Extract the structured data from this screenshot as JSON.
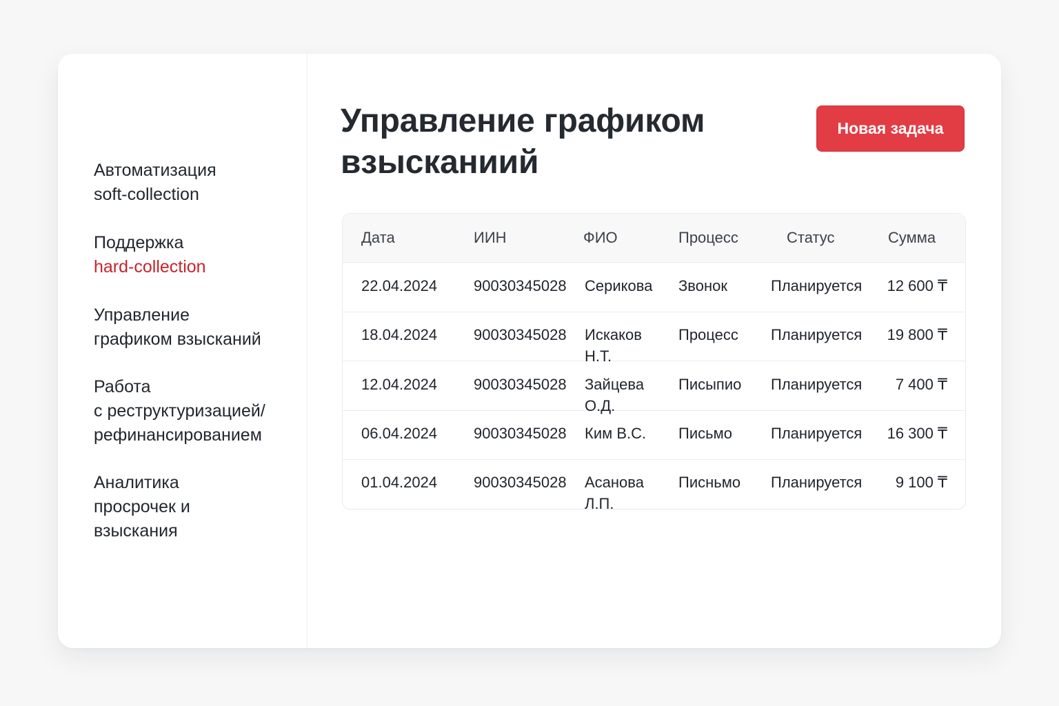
{
  "sidebar": {
    "items": [
      {
        "lines": [
          "Автоматизация",
          "soft-collection"
        ]
      },
      {
        "line1": "Поддержка",
        "line2": "hard-collection"
      },
      {
        "lines": [
          "Управление",
          "графиком взысканий"
        ]
      },
      {
        "lines": [
          "Работа",
          "с реструктуризацией/",
          "рефинансированием"
        ]
      },
      {
        "lines": [
          "Аналитика",
          "просрочек и",
          "взыскания"
        ]
      }
    ]
  },
  "colors": {
    "accent": "#c8232b",
    "button": "#e23d45"
  },
  "header": {
    "title_lines": [
      "Управление графиком",
      "взысканиий"
    ],
    "new_task_label": "Новая задача"
  },
  "table": {
    "columns": [
      "Дата",
      "ИИН",
      "ФИО",
      "Процесс",
      "Статус",
      "Сумма"
    ],
    "rows": [
      {
        "date": "22.04.2024",
        "iin": "90030345028",
        "fio": "Серикова",
        "process": "Звонок",
        "status": "Планируется",
        "sum": "12 600 ₸"
      },
      {
        "date": "18.04.2024",
        "iin": "90030345028",
        "fio": "Искаков Н.Т.",
        "process": "Процесс",
        "status": "Планируется",
        "sum": "19 800 ₸"
      },
      {
        "date": "12.04.2024",
        "iin": "90030345028",
        "fio": "Зайцева О.Д.",
        "process": "Писыпио",
        "status": "Планируется",
        "sum": "7 400 ₸"
      },
      {
        "date": "06.04.2024",
        "iin": "90030345028",
        "fio": "Ким В.С.",
        "process": "Письмо",
        "status": "Планируется",
        "sum": "16 300 ₸"
      },
      {
        "date": "01.04.2024",
        "iin": "90030345028",
        "fio": "Асанова Л.П.",
        "process": "Писньмо",
        "status": "Планируется",
        "sum": "9 100 ₸"
      }
    ]
  }
}
